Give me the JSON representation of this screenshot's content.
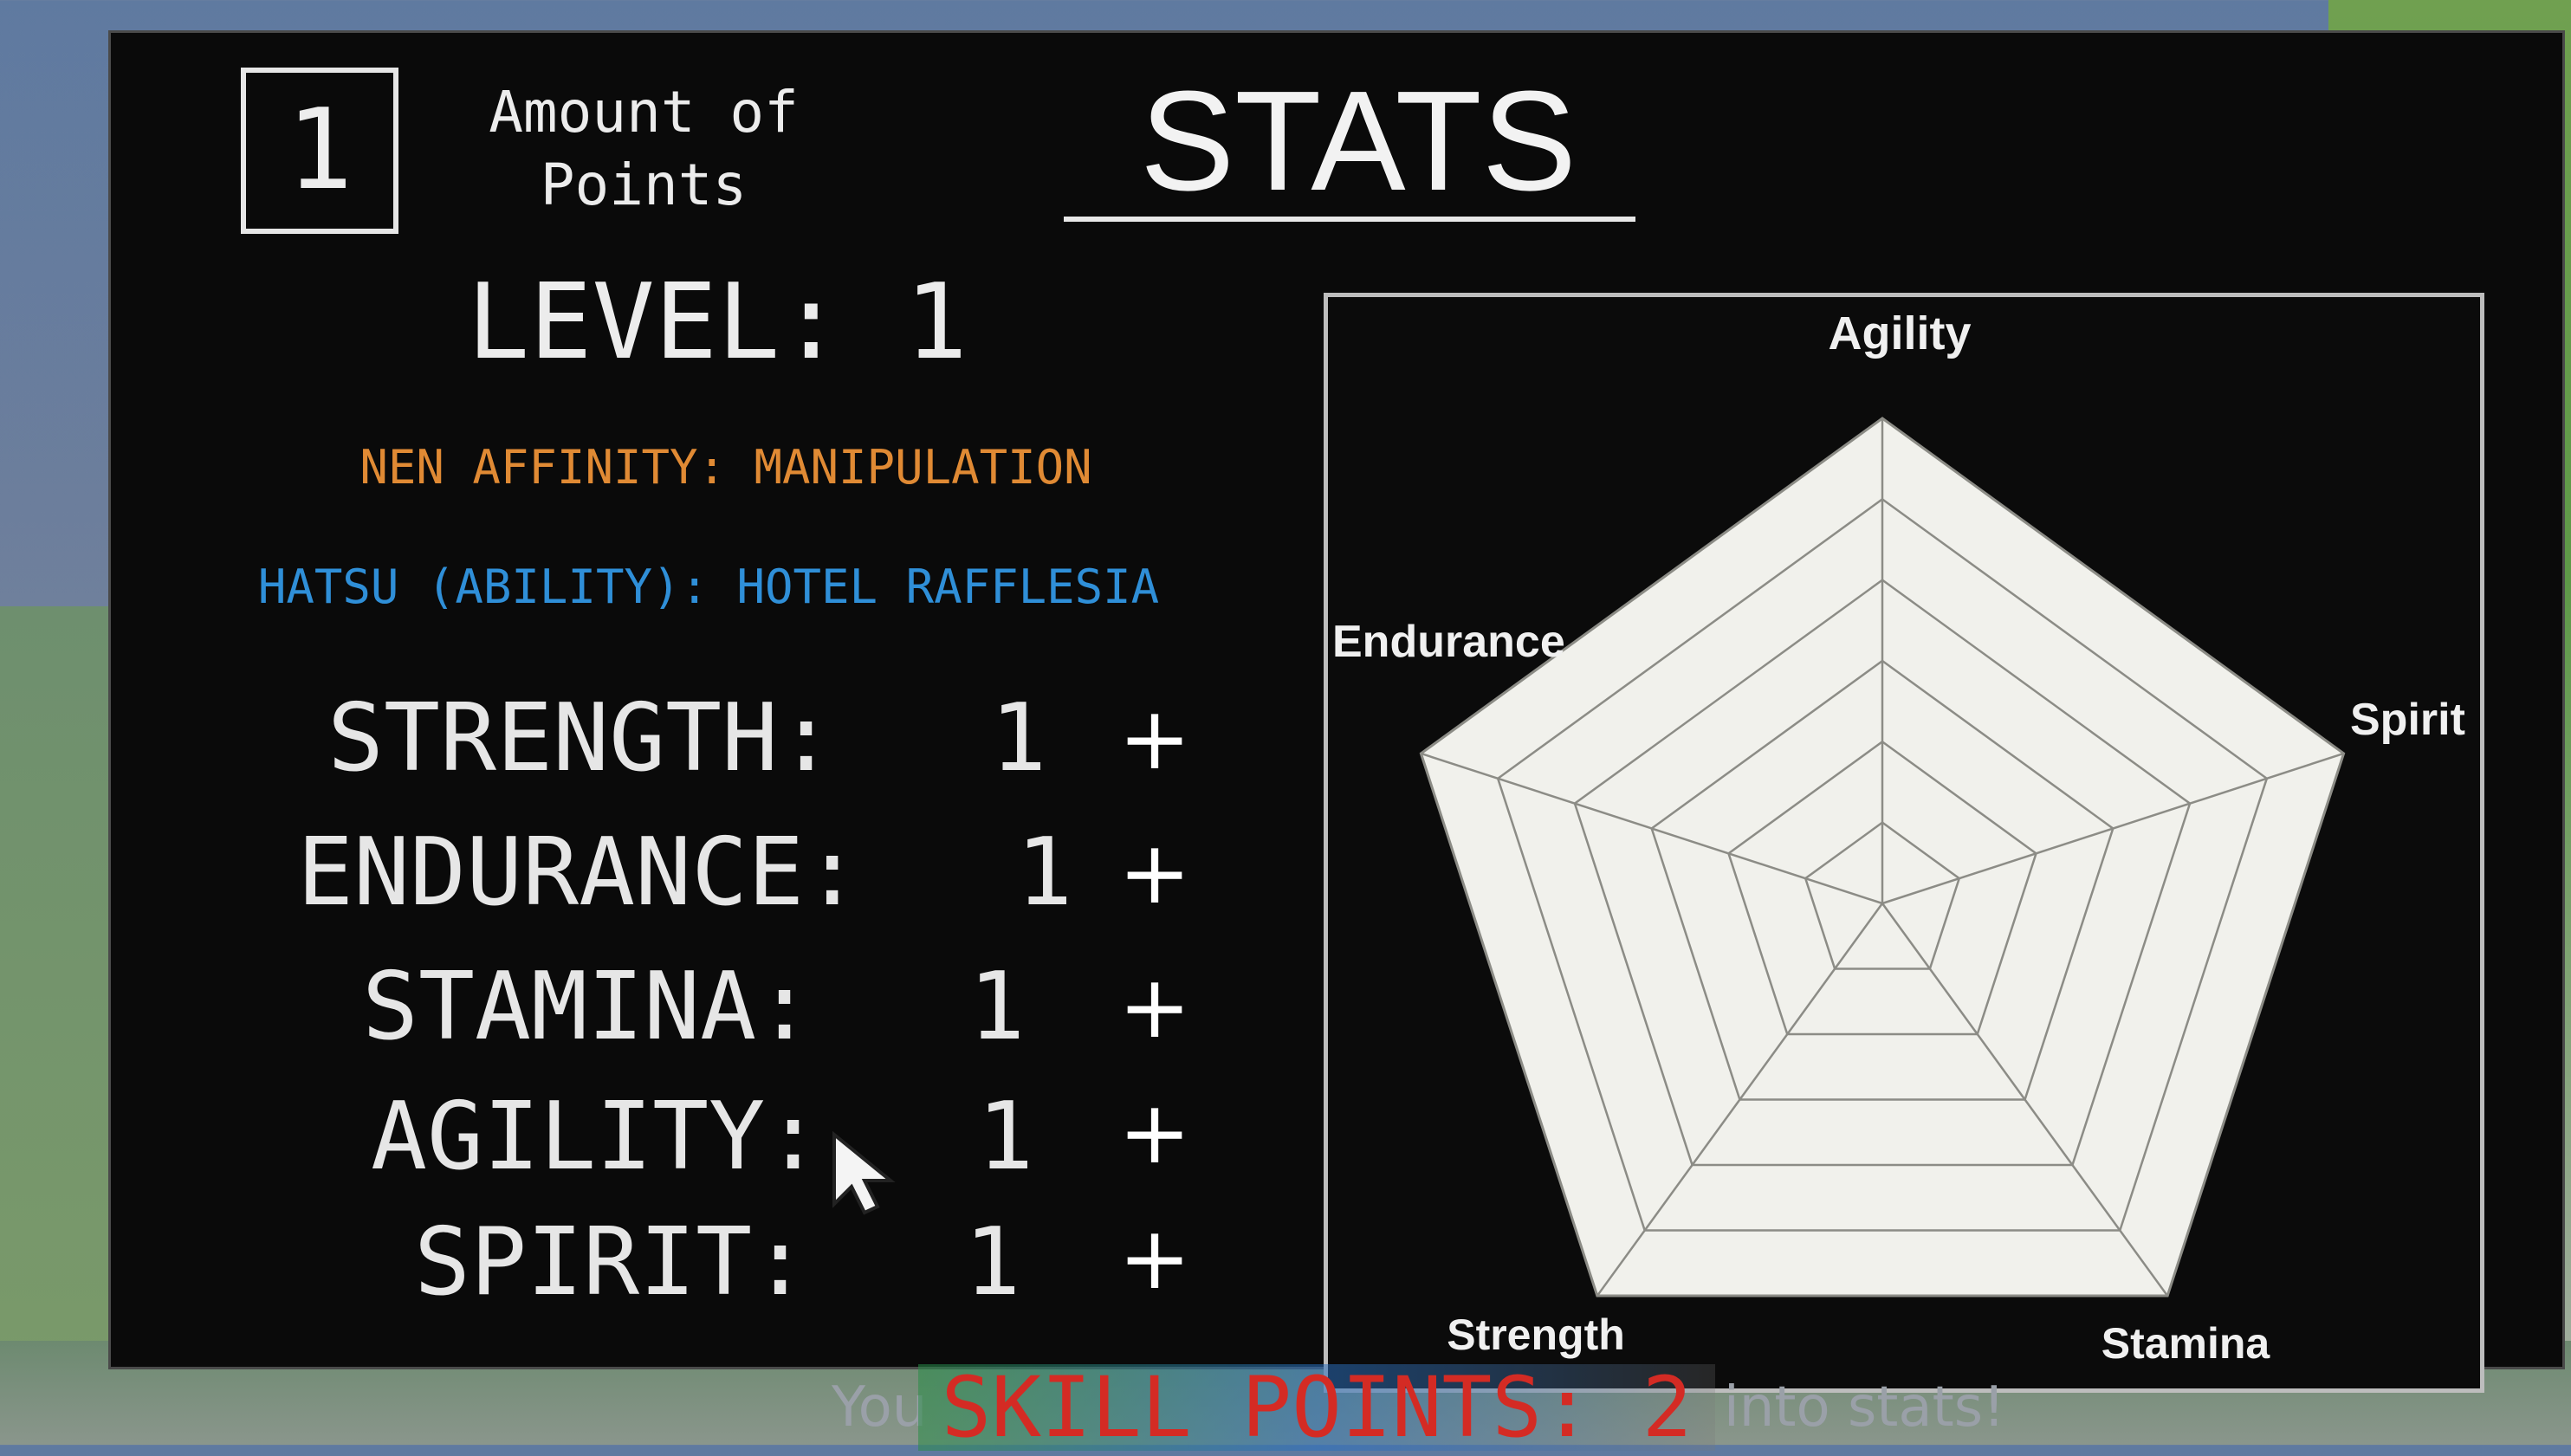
{
  "points_box": {
    "value": "1",
    "label": "Amount of\nPoints"
  },
  "title": "STATS",
  "level": "LEVEL: 1",
  "nen_affinity": "NEN AFFINITY: MANIPULATION",
  "hatsu": "HATSU (ABILITY): HOTEL RAFFLESIA",
  "stats": [
    {
      "label": "STRENGTH:",
      "value": "1",
      "plus": "+"
    },
    {
      "label": "ENDURANCE:",
      "value": "1",
      "plus": "+"
    },
    {
      "label": "STAMINA:",
      "value": "1",
      "plus": "+"
    },
    {
      "label": "AGILITY:",
      "value": "1",
      "plus": "+"
    },
    {
      "label": "SPIRIT:",
      "value": "1",
      "plus": "+"
    }
  ],
  "radar_labels": {
    "agility": "Agility",
    "endurance": "Endurance",
    "spirit": "Spirit",
    "strength": "Strength",
    "stamina": "Stamina"
  },
  "radar_values": {
    "agility": 1,
    "spirit": 1,
    "stamina": 1,
    "strength": 1,
    "endurance": 1
  },
  "skill_points": "SKILL POINTS: 2",
  "hint_fragments": {
    "left": "You",
    "right": "into stats!"
  },
  "colors": {
    "panel_bg": "#0a0a0a",
    "affinity": "#e08a34",
    "hatsu": "#2f8fd8",
    "skill_points": "#d42b24",
    "radar_fill": "#f1f1ec",
    "radar_grid": "#8c8c86"
  }
}
